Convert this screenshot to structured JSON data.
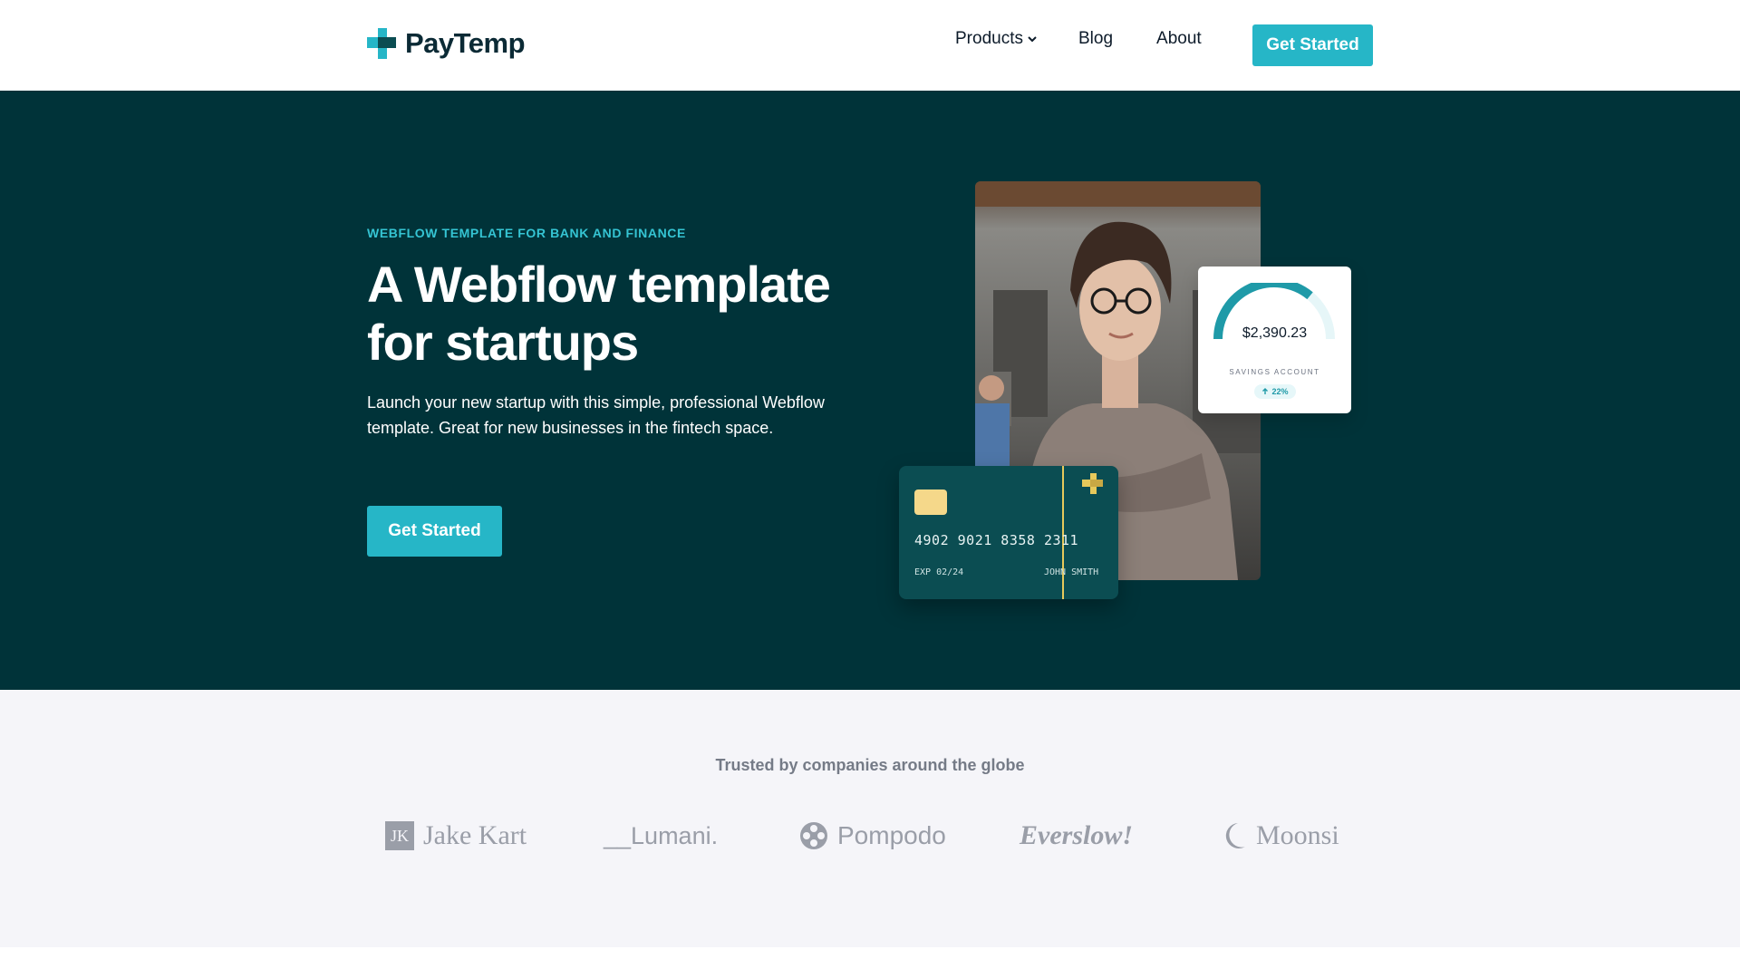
{
  "nav": {
    "brand": "PayTemp",
    "links": [
      {
        "label": "Products"
      },
      {
        "label": "Blog"
      },
      {
        "label": "About"
      }
    ],
    "cta_label": "Get Started"
  },
  "hero": {
    "eyebrow": "WEBFLOW TEMPLATE FOR BANK AND FINANCE",
    "headline": "A Webflow template for startups",
    "subtext": "Launch your new startup with this simple, professional Webflow template. Great for new businesses in the fintech space.",
    "cta_label": "Get Started"
  },
  "savings_card": {
    "amount": "$2,390.23",
    "label": "SAVINGS ACCOUNT",
    "change": "22%",
    "gauge_fraction": 0.72
  },
  "credit_card": {
    "number": "4902 9021 8358 2311",
    "exp": "EXP 02/24",
    "holder": "JOHN SMITH"
  },
  "trust": {
    "title": "Trusted by companies around the globe",
    "companies": [
      {
        "name": "Jake Kart",
        "mark": "JK"
      },
      {
        "name": "__Lumani."
      },
      {
        "name": "Pompodo"
      },
      {
        "name": "Everslow!"
      },
      {
        "name": "Moonsi"
      }
    ]
  },
  "colors": {
    "accent": "#26b6c7",
    "hero_bg": "#003339",
    "trust_bg": "#f5f5f9"
  }
}
